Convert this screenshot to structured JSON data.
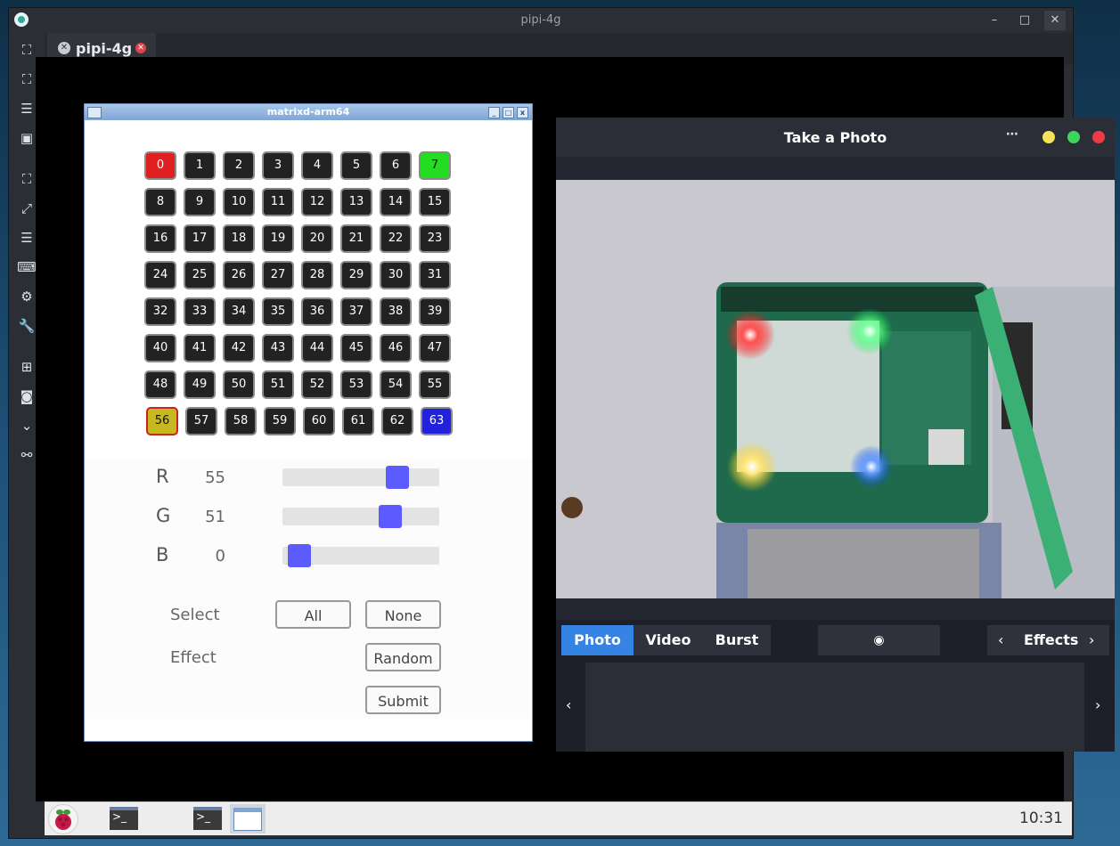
{
  "window": {
    "title": "pipi-4g"
  },
  "tab": {
    "label": "pipi-4g"
  },
  "matrix_window": {
    "title": "matrixd-arm64",
    "leds": [
      "0",
      "1",
      "2",
      "3",
      "4",
      "5",
      "6",
      "7",
      "8",
      "9",
      "10",
      "11",
      "12",
      "13",
      "14",
      "15",
      "16",
      "17",
      "18",
      "19",
      "20",
      "21",
      "22",
      "23",
      "24",
      "25",
      "26",
      "27",
      "28",
      "29",
      "30",
      "31",
      "32",
      "33",
      "34",
      "35",
      "36",
      "37",
      "38",
      "39",
      "40",
      "41",
      "42",
      "43",
      "44",
      "45",
      "46",
      "47",
      "48",
      "49",
      "50",
      "51",
      "52",
      "53",
      "54",
      "55",
      "56",
      "57",
      "58",
      "59",
      "60",
      "61",
      "62",
      "63"
    ],
    "led_colors": {
      "0": "red",
      "7": "green",
      "56": "yellow",
      "63": "blue"
    },
    "channels": [
      {
        "label": "R",
        "value": "55",
        "level": 55
      },
      {
        "label": "G",
        "value": "51",
        "level": 51
      },
      {
        "label": "B",
        "value": "0",
        "level": 0
      }
    ],
    "slider_max": 63,
    "select_label": "Select",
    "effect_label": "Effect",
    "btn_all": "All",
    "btn_none": "None",
    "btn_random": "Random",
    "btn_submit": "Submit"
  },
  "camera": {
    "title": "Take a Photo",
    "menu_glyph": "⋯",
    "modes": [
      "Photo",
      "Video",
      "Burst"
    ],
    "active_mode": "Photo",
    "effects_label": "Effects"
  },
  "taskbar": {
    "clock": "10:31"
  },
  "colors": {
    "accent": "#3584e4",
    "slider": "#5b5bff",
    "led_red": "#e02020",
    "led_green": "#22dd22",
    "led_yellow": "#c8b820",
    "led_blue": "#2222dd"
  }
}
